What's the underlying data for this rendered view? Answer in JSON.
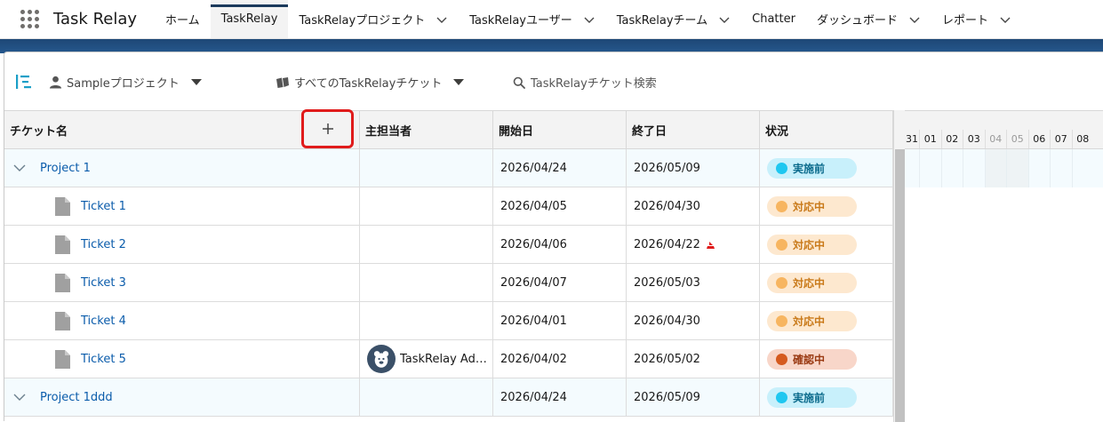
{
  "app": {
    "title": "Task Relay"
  },
  "nav": {
    "items": [
      {
        "label": "ホーム",
        "dropdown": false,
        "active": false
      },
      {
        "label": "TaskRelay",
        "dropdown": false,
        "active": true
      },
      {
        "label": "TaskRelayプロジェクト",
        "dropdown": true,
        "active": false
      },
      {
        "label": "TaskRelayユーザー",
        "dropdown": true,
        "active": false
      },
      {
        "label": "TaskRelayチーム",
        "dropdown": true,
        "active": false
      },
      {
        "label": "Chatter",
        "dropdown": false,
        "active": false
      },
      {
        "label": "ダッシュボード",
        "dropdown": true,
        "active": false
      },
      {
        "label": "レポート",
        "dropdown": true,
        "active": false
      }
    ]
  },
  "toolbar": {
    "project_select": "Sampleプロジェクト",
    "ticket_filter": "すべてのTaskRelayチケット",
    "search_placeholder": "TaskRelayチケット検索"
  },
  "grid": {
    "columns": {
      "name": "チケット名",
      "assignee": "主担当者",
      "start": "開始日",
      "end": "終了日",
      "status": "状況"
    },
    "add_button_symbol": "+",
    "rows": [
      {
        "type": "project",
        "name": "Project 1",
        "assignee": "",
        "start": "2026/04/24",
        "end": "2026/05/09",
        "status": "実施前",
        "status_kind": "pre",
        "flag": false
      },
      {
        "type": "ticket",
        "name": "Ticket 1",
        "assignee": "",
        "start": "2026/04/05",
        "end": "2026/04/30",
        "status": "対応中",
        "status_kind": "prog",
        "flag": false
      },
      {
        "type": "ticket",
        "name": "Ticket 2",
        "assignee": "",
        "start": "2026/04/06",
        "end": "2026/04/22",
        "status": "対応中",
        "status_kind": "prog",
        "flag": true
      },
      {
        "type": "ticket",
        "name": "Ticket 3",
        "assignee": "",
        "start": "2026/04/07",
        "end": "2026/05/03",
        "status": "対応中",
        "status_kind": "prog",
        "flag": false
      },
      {
        "type": "ticket",
        "name": "Ticket 4",
        "assignee": "",
        "start": "2026/04/01",
        "end": "2026/04/30",
        "status": "対応中",
        "status_kind": "prog",
        "flag": false
      },
      {
        "type": "ticket",
        "name": "Ticket 5",
        "assignee": "TaskRelay Adm...",
        "start": "2026/04/02",
        "end": "2026/05/02",
        "status": "確認中",
        "status_kind": "chk",
        "flag": false
      },
      {
        "type": "project",
        "name": "Project 1ddd",
        "assignee": "",
        "start": "2026/04/24",
        "end": "2026/05/09",
        "status": "実施前",
        "status_kind": "pre",
        "flag": false
      }
    ]
  },
  "timeline": {
    "days": [
      {
        "label": "31",
        "weekend": false
      },
      {
        "label": "01",
        "weekend": false
      },
      {
        "label": "02",
        "weekend": false
      },
      {
        "label": "03",
        "weekend": false
      },
      {
        "label": "04",
        "weekend": true
      },
      {
        "label": "05",
        "weekend": true
      },
      {
        "label": "06",
        "weekend": false
      },
      {
        "label": "07",
        "weekend": false
      },
      {
        "label": "08",
        "weekend": false
      }
    ]
  },
  "colors": {
    "link": "#0b5cab",
    "highlight": "#e01b1b",
    "band": "#1e4876"
  }
}
